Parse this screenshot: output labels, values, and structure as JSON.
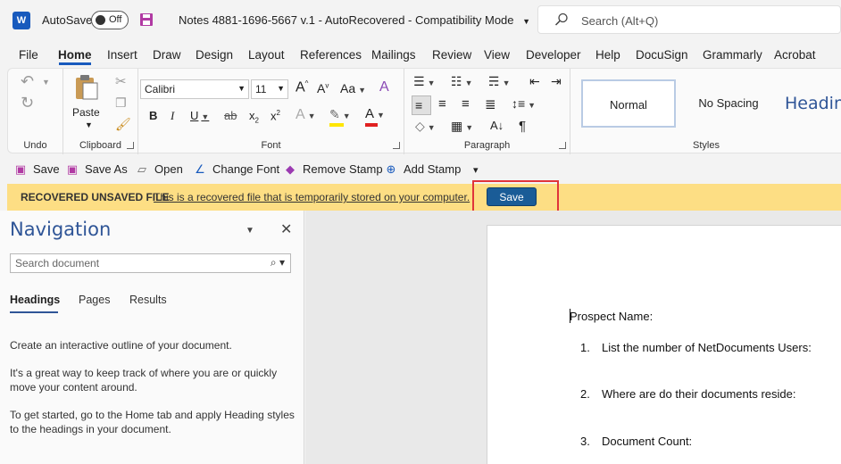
{
  "titlebar": {
    "app_logo": "W",
    "autosave_label": "AutoSave",
    "autosave_state": "Off",
    "doc_title": "Notes 4881-1696-5667 v.1  -  AutoRecovered  -  Compatibility Mode",
    "search_placeholder": "Search (Alt+Q)",
    "icons": [
      "word-logo-icon",
      "save-icon",
      "chevron-down-icon",
      "search-icon"
    ]
  },
  "menu": {
    "items": [
      "File",
      "Home",
      "Insert",
      "Draw",
      "Design",
      "Layout",
      "References",
      "Mailings",
      "Review",
      "View",
      "Developer",
      "Help",
      "DocuSign",
      "Grammarly",
      "Acrobat"
    ],
    "active": "Home"
  },
  "ribbon": {
    "undo": {
      "label": "Undo",
      "undo_glyph": "↶",
      "redo_glyph": "↻"
    },
    "clipboard": {
      "label": "Clipboard",
      "paste_label": "Paste"
    },
    "font": {
      "label": "Font",
      "font_name": "Calibri",
      "font_size": "11",
      "grow": "A",
      "shrink": "A",
      "case": "Aa",
      "bold": "B",
      "italic": "I",
      "underline": "U",
      "strike": "ab",
      "subscript": "x",
      "subscript_num": "2",
      "superscript": "x",
      "superscript_num": "2",
      "effects": "A",
      "font_color": "A",
      "highlight_color": "#ffe600",
      "font_color_bar": "#e02020"
    },
    "paragraph": {
      "label": "Paragraph",
      "pilcrow": "¶"
    },
    "styles": {
      "label": "Styles",
      "items": [
        "Normal",
        "No Spacing",
        "Heading"
      ]
    }
  },
  "quick_access": {
    "buttons": [
      {
        "label": "Save",
        "icon": "save-icon"
      },
      {
        "label": "Save As",
        "icon": "save-as-icon"
      },
      {
        "label": "Open",
        "icon": "folder-open-icon"
      },
      {
        "label": "Change Font",
        "icon": "change-font-icon"
      },
      {
        "label": "Remove Stamp",
        "icon": "eraser-icon"
      },
      {
        "label": "Add Stamp",
        "icon": "stamp-icon"
      }
    ],
    "more_glyph": "▾"
  },
  "recovered_bar": {
    "title": "RECOVERED UNSAVED FILE",
    "message": "This is a recovered file that is temporarily stored on your computer.",
    "save_label": "Save",
    "highlight_color": "#e0343a",
    "bar_color": "#fdde84",
    "button_color": "#1a5c97"
  },
  "navigation": {
    "title": "Navigation",
    "search_placeholder": "Search document",
    "tabs": [
      "Headings",
      "Pages",
      "Results"
    ],
    "active_tab": "Headings",
    "paragraphs": [
      "Create an interactive outline of your document.",
      "It's a great way to keep track of where you are or quickly move your content around.",
      "To get started, go to the Home tab and apply Heading styles to the headings in your document."
    ]
  },
  "document": {
    "lines": [
      "Prospect Name:",
      "List the number of NetDocuments Users:",
      "Where are do their documents reside:",
      "Document Count:"
    ],
    "list_numbers": [
      "1.",
      "2.",
      "3."
    ]
  },
  "colors": {
    "accent": "#185abd",
    "nav_title": "#2f5597"
  }
}
